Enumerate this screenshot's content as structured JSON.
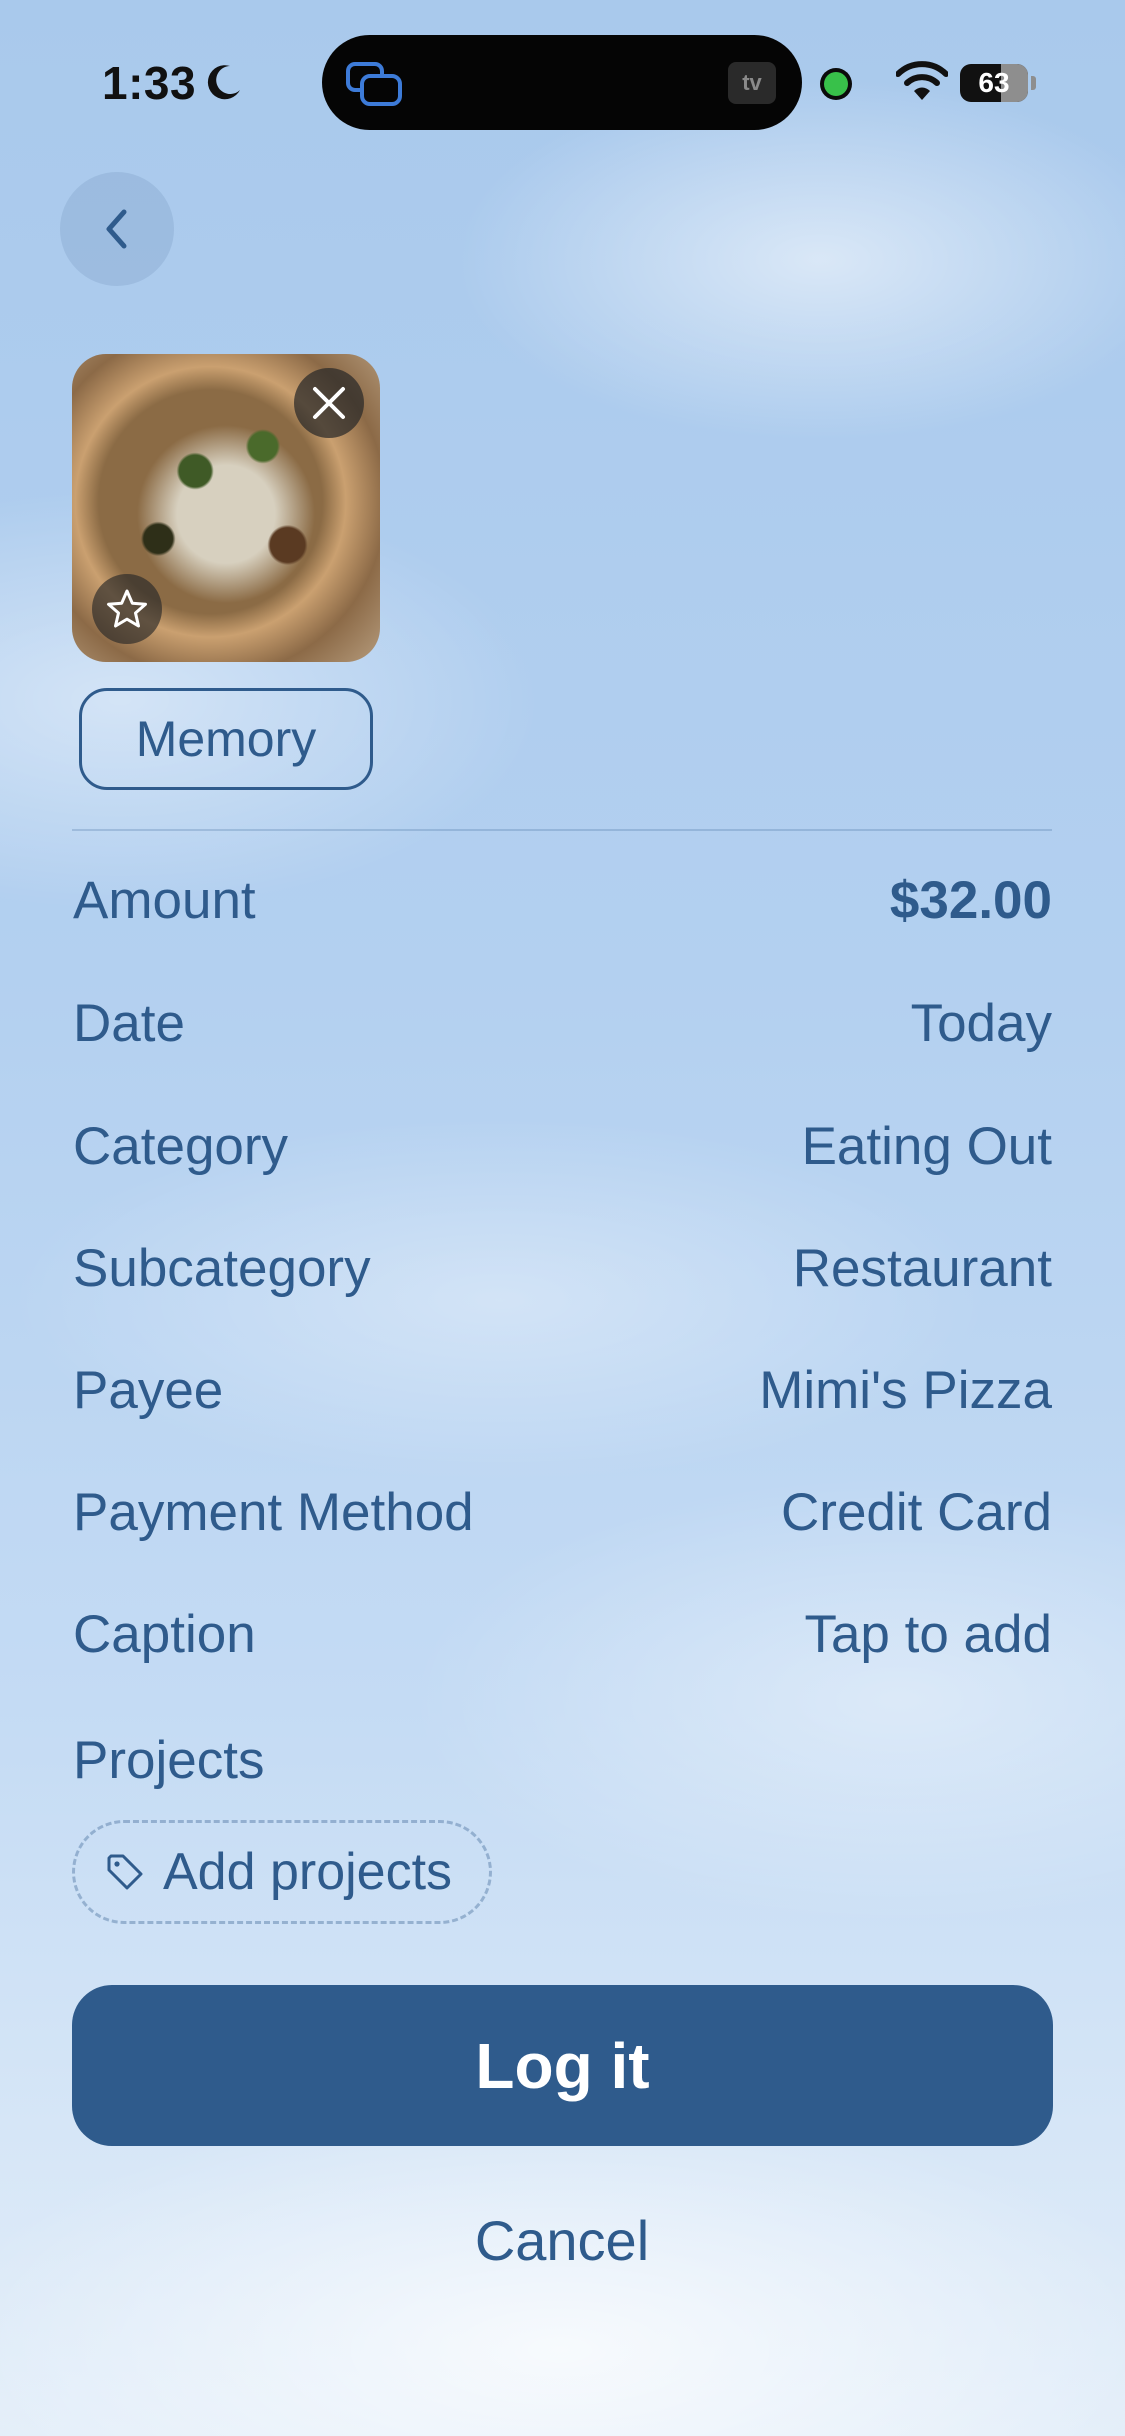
{
  "status_bar": {
    "time": "1:33",
    "battery": "63",
    "tv_badge": "tv"
  },
  "photo": {
    "subject": "pizza"
  },
  "memory_button": "Memory",
  "fields": [
    {
      "label": "Amount",
      "value": "$32.00"
    },
    {
      "label": "Date",
      "value": "Today"
    },
    {
      "label": "Category",
      "value": "Eating Out"
    },
    {
      "label": "Subcategory",
      "value": "Restaurant"
    },
    {
      "label": "Payee",
      "value": "Mimi's Pizza"
    },
    {
      "label": "Payment Method",
      "value": "Credit Card"
    },
    {
      "label": "Caption",
      "value": "Tap to add"
    }
  ],
  "projects": {
    "label": "Projects",
    "add_label": "Add projects"
  },
  "actions": {
    "primary": "Log it",
    "cancel": "Cancel"
  },
  "colors": {
    "accent": "#2f5b8c",
    "background_top": "#a9c9ec",
    "background_bottom": "#e3eef9"
  }
}
